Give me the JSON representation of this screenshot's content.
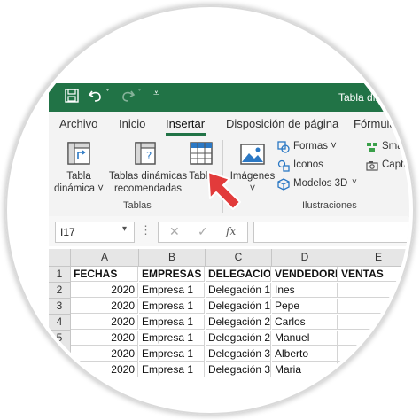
{
  "window": {
    "title": "Tabla diná"
  },
  "ribbon_tabs": [
    "Archivo",
    "Inicio",
    "Insertar",
    "Disposición de página",
    "Fórmulas"
  ],
  "ribbon": {
    "tabla_dinamica": [
      "Tabla",
      "dinámica ˅"
    ],
    "tablas_recomendadas": [
      "Tablas dinámicas",
      "recomendadas"
    ],
    "tabla": "Tabla",
    "imagenes": [
      "Imágenes",
      "˅"
    ],
    "formas": "Formas ˅",
    "iconos": "Iconos",
    "modelos3d": "Modelos 3D",
    "smart": "Smart",
    "captura": "Captur",
    "group_tablas": "Tablas",
    "group_ilustraciones": "Ilustraciones"
  },
  "formula_bar": {
    "name_box": "I17",
    "fx": "fx"
  },
  "sheet": {
    "columns": [
      "A",
      "B",
      "C",
      "D",
      "E"
    ],
    "rows": [
      {
        "n": "1",
        "cells": [
          "FECHAS",
          "EMPRESAS",
          "DELEGACION",
          "VENDEDORES",
          "VENTAS"
        ]
      },
      {
        "n": "2",
        "cells": [
          "2020",
          "Empresa 1",
          "Delegación 1",
          "Ines",
          ""
        ]
      },
      {
        "n": "3",
        "cells": [
          "2020",
          "Empresa 1",
          "Delegación 1",
          "Pepe",
          ""
        ]
      },
      {
        "n": "4",
        "cells": [
          "2020",
          "Empresa 1",
          "Delegación 2",
          "Carlos",
          ""
        ]
      },
      {
        "n": "5",
        "cells": [
          "2020",
          "Empresa 1",
          "Delegación 2",
          "Manuel",
          ""
        ]
      },
      {
        "n": "6",
        "cells": [
          "2020",
          "Empresa 1",
          "Delegación 3",
          "Alberto",
          ""
        ]
      },
      {
        "n": "7",
        "cells": [
          "2020",
          "Empresa 1",
          "Delegación 3",
          "Maria",
          ""
        ]
      }
    ]
  },
  "colors": {
    "excel_green": "#217346",
    "pointer_red": "#e23b3b"
  }
}
